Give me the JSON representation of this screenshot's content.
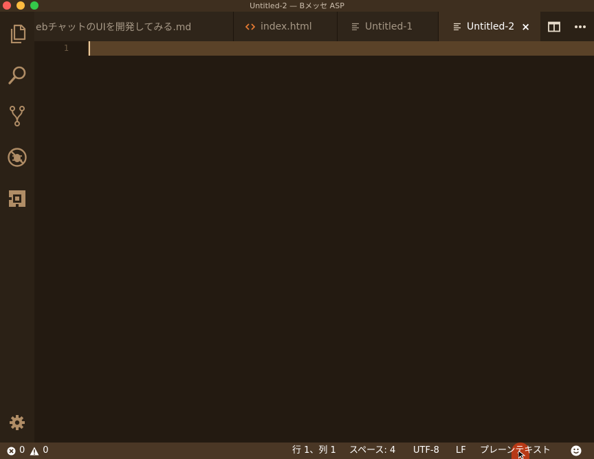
{
  "window": {
    "title": "Untitled-2 — Bメッセ ASP"
  },
  "activity_bar": {
    "items": [
      {
        "name": "explorer",
        "icon": "files-icon"
      },
      {
        "name": "search",
        "icon": "search-icon"
      },
      {
        "name": "source-control",
        "icon": "git-branch-icon"
      },
      {
        "name": "debug",
        "icon": "debug-icon"
      },
      {
        "name": "extensions",
        "icon": "extensions-icon"
      }
    ],
    "settings_icon": "gear-icon"
  },
  "tabs": [
    {
      "label": "ebチャットのUIを開発してみる.md",
      "icon": "",
      "active": false
    },
    {
      "label": "index.html",
      "icon": "html-code-icon",
      "active": false
    },
    {
      "label": "Untitled-1",
      "icon": "text-file-icon",
      "active": false
    },
    {
      "label": "Untitled-2",
      "icon": "text-file-icon",
      "active": true,
      "close": "×"
    }
  ],
  "tab_actions": {
    "split": "split-editor-icon",
    "more": "more-icon"
  },
  "editor": {
    "line_numbers": [
      "1"
    ],
    "content": ""
  },
  "status_bar": {
    "errors": "0",
    "warnings": "0",
    "position": "行 1、列 1",
    "indent": "スペース: 4",
    "encoding": "UTF-8",
    "eol": "LF",
    "language": "プレーンテキスト",
    "feedback_icon": "smiley-icon"
  },
  "colors": {
    "background": "#231a11",
    "titlebar": "#3e2f1f",
    "activitybar": "#2b2116",
    "active_tab": "#3e2f1f",
    "line_highlight": "#5a4228",
    "statusbar": "#4a3725",
    "icon": "#b08d66"
  }
}
